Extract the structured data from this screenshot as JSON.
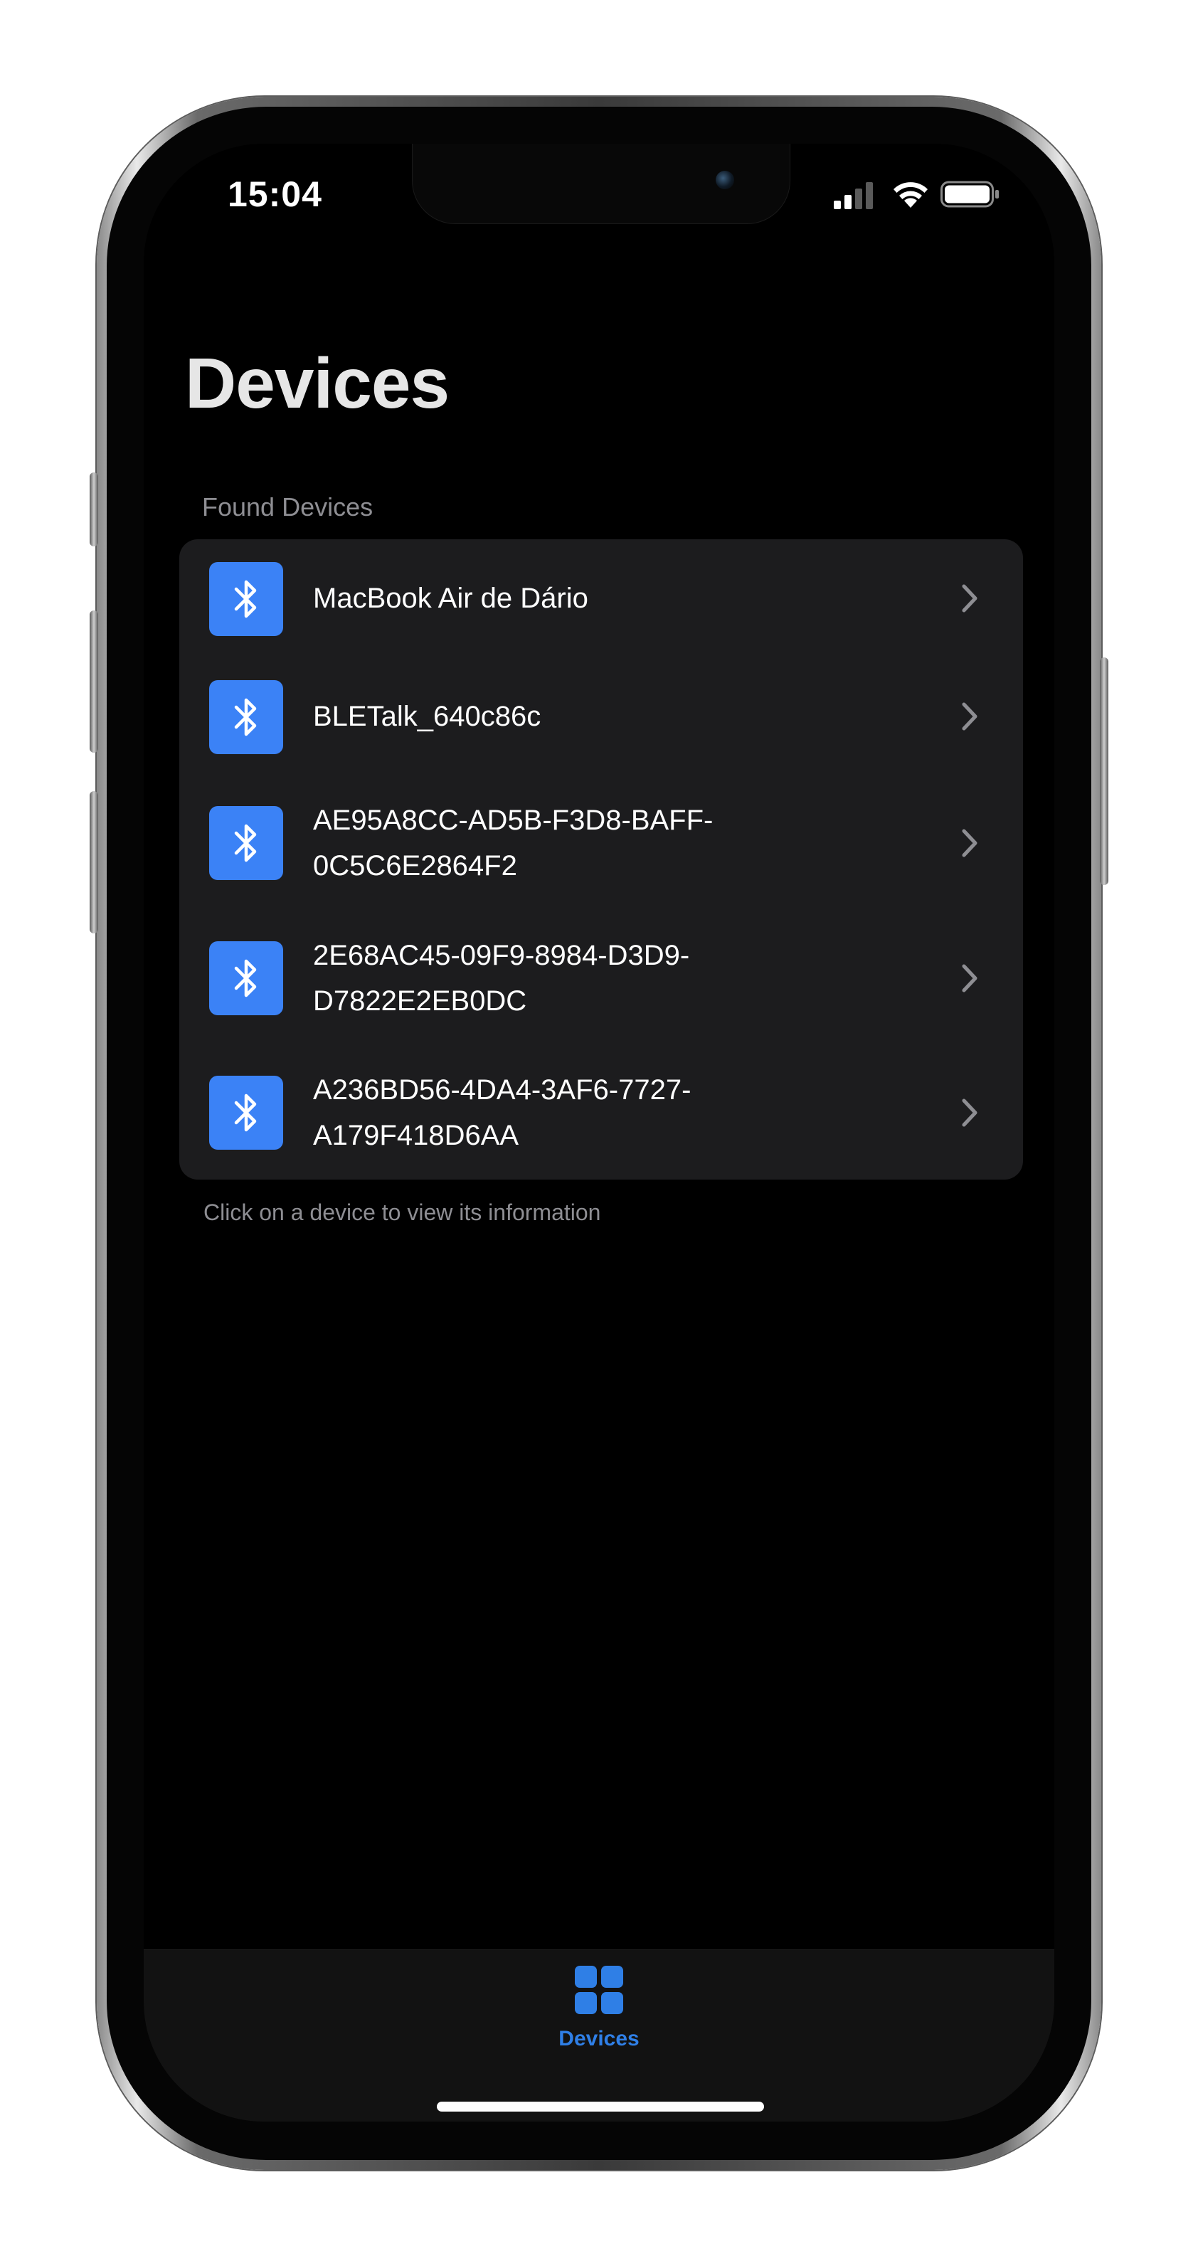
{
  "status_bar": {
    "time": "15:04",
    "icons": [
      "cellular-signal-icon",
      "wifi-icon",
      "battery-icon"
    ]
  },
  "page": {
    "title": "Devices"
  },
  "devices_section": {
    "header": "Found Devices",
    "footer": "Click on a device to view its information",
    "items": [
      {
        "label": "MacBook Air de Dário",
        "icon": "bluetooth-icon"
      },
      {
        "label": "BLETalk_640c86c",
        "icon": "bluetooth-icon"
      },
      {
        "label": "AE95A8CC-AD5B-F3D8-BAFF-0C5C6E2864F2",
        "icon": "bluetooth-icon"
      },
      {
        "label": "2E68AC45-09F9-8984-D3D9-D7822E2EB0DC",
        "icon": "bluetooth-icon"
      },
      {
        "label": "A236BD56-4DA4-3AF6-7727-A179F418D6AA",
        "icon": "bluetooth-icon"
      }
    ]
  },
  "tab_bar": {
    "tabs": [
      {
        "label": "Devices",
        "icon": "grid-icon",
        "selected": true
      }
    ]
  },
  "colors": {
    "accent": "#3b82f6",
    "tab_active": "#2f7fe6",
    "list_background": "#1c1c1e",
    "screen_background": "#000000"
  }
}
